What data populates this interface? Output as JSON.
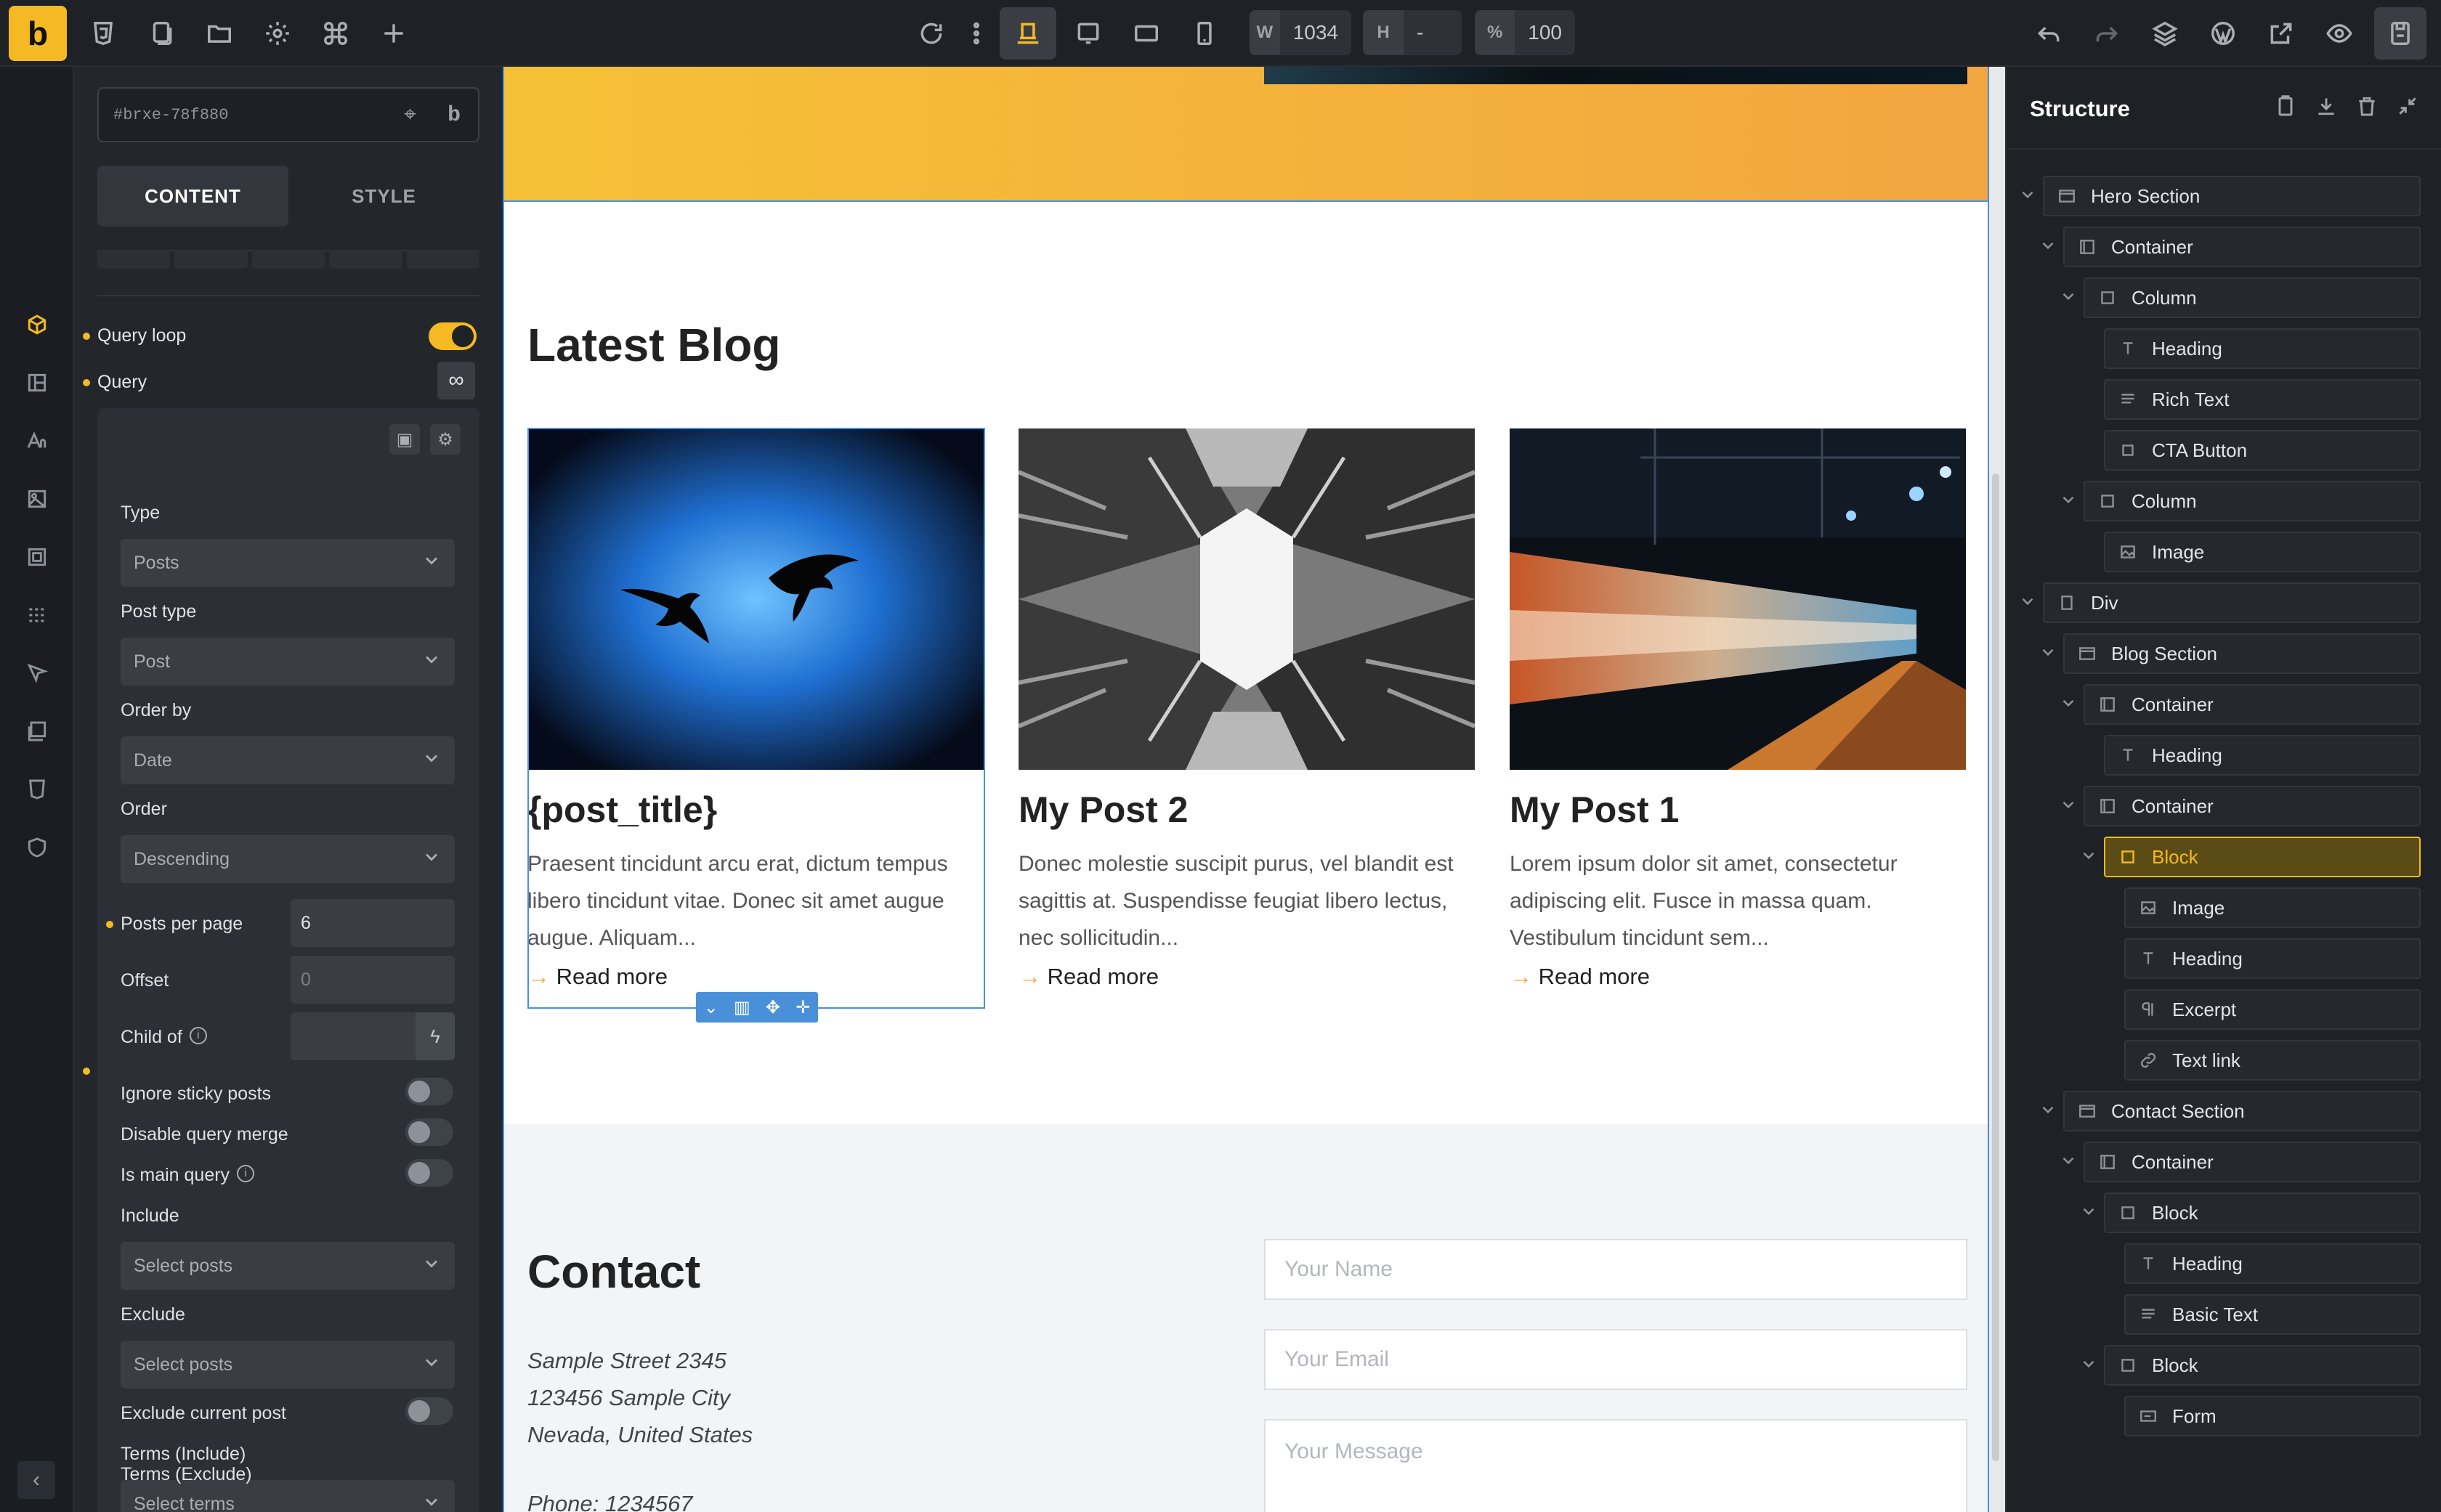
{
  "toolbar": {
    "logo": "b",
    "width_label": "W",
    "width_value": "1034",
    "height_label": "H",
    "height_value": "-",
    "zoom_label": "%",
    "zoom_value": "100"
  },
  "panel": {
    "element_id": "#brxe-78f880",
    "tab_content": "CONTENT",
    "tab_style": "STYLE",
    "query_loop_label": "Query loop",
    "query_label": "Query",
    "query": {
      "type_label": "Type",
      "type_value": "Posts",
      "post_type_label": "Post type",
      "post_type_value": "Post",
      "order_by_label": "Order by",
      "order_by_value": "Date",
      "order_label": "Order",
      "order_value": "Descending",
      "posts_per_page_label": "Posts per page",
      "posts_per_page_value": "6",
      "offset_label": "Offset",
      "offset_placeholder": "0",
      "child_of_label": "Child of",
      "ignore_sticky_label": "Ignore sticky posts",
      "disable_merge_label": "Disable query merge",
      "is_main_label": "Is main query",
      "include_label": "Include",
      "include_placeholder": "Select posts",
      "exclude_label": "Exclude",
      "exclude_placeholder": "Select posts",
      "exclude_current_label": "Exclude current post",
      "terms_include_label": "Terms (Include)",
      "terms_include_placeholder": "Select terms",
      "terms_exclude_label": "Terms (Exclude)"
    }
  },
  "canvas": {
    "blog_heading": "Latest Blog",
    "posts": [
      {
        "title": "{post_title}",
        "excerpt": "Praesent tincidunt arcu erat, dictum tempus libero tincidunt vitae. Donec sit amet augue augue. Aliquam...",
        "read_more": "Read more"
      },
      {
        "title": "My Post 2",
        "excerpt": "Donec molestie suscipit purus, vel blandit est sagittis at. Suspendisse feugiat libero lectus, nec sollicitudin...",
        "read_more": "Read more"
      },
      {
        "title": "My Post 1",
        "excerpt": "Lorem ipsum dolor sit amet, consectetur adipiscing elit. Fusce in massa quam. Vestibulum tincidunt sem...",
        "read_more": "Read more"
      }
    ],
    "contact_heading": "Contact",
    "address": [
      "Sample Street 2345",
      "123456 Sample City",
      "Nevada, United States"
    ],
    "phone": "Phone: 1234567",
    "form": {
      "name_placeholder": "Your Name",
      "email_placeholder": "Your Email",
      "message_placeholder": "Your Message"
    }
  },
  "structure": {
    "title": "Structure",
    "nodes": [
      {
        "label": "Hero Section",
        "icon": "section-icon"
      },
      {
        "label": "Container",
        "icon": "container-icon"
      },
      {
        "label": "Column",
        "icon": "block-icon"
      },
      {
        "label": "Heading",
        "icon": "heading-icon"
      },
      {
        "label": "Rich Text",
        "icon": "text-icon"
      },
      {
        "label": "CTA Button",
        "icon": "button-icon"
      },
      {
        "label": "Column",
        "icon": "block-icon"
      },
      {
        "label": "Image",
        "icon": "image-icon"
      },
      {
        "label": "Div",
        "icon": "div-icon"
      },
      {
        "label": "Blog Section",
        "icon": "section-icon"
      },
      {
        "label": "Container",
        "icon": "container-icon"
      },
      {
        "label": "Heading",
        "icon": "heading-icon"
      },
      {
        "label": "Container",
        "icon": "container-icon"
      },
      {
        "label": "Block",
        "icon": "block-icon"
      },
      {
        "label": "Image",
        "icon": "image-icon"
      },
      {
        "label": "Heading",
        "icon": "heading-icon"
      },
      {
        "label": "Excerpt",
        "icon": "paragraph-icon"
      },
      {
        "label": "Text link",
        "icon": "link-icon"
      },
      {
        "label": "Contact Section",
        "icon": "section-icon"
      },
      {
        "label": "Container",
        "icon": "container-icon"
      },
      {
        "label": "Block",
        "icon": "block-icon"
      },
      {
        "label": "Heading",
        "icon": "heading-icon"
      },
      {
        "label": "Basic Text",
        "icon": "text-icon"
      },
      {
        "label": "Block",
        "icon": "block-icon"
      },
      {
        "label": "Form",
        "icon": "form-icon"
      }
    ]
  },
  "colors": {
    "accent": "#f5b923",
    "selection": "#4a90d9",
    "hero_gradient_start": "#f6c136",
    "hero_gradient_end": "#f2a640"
  }
}
